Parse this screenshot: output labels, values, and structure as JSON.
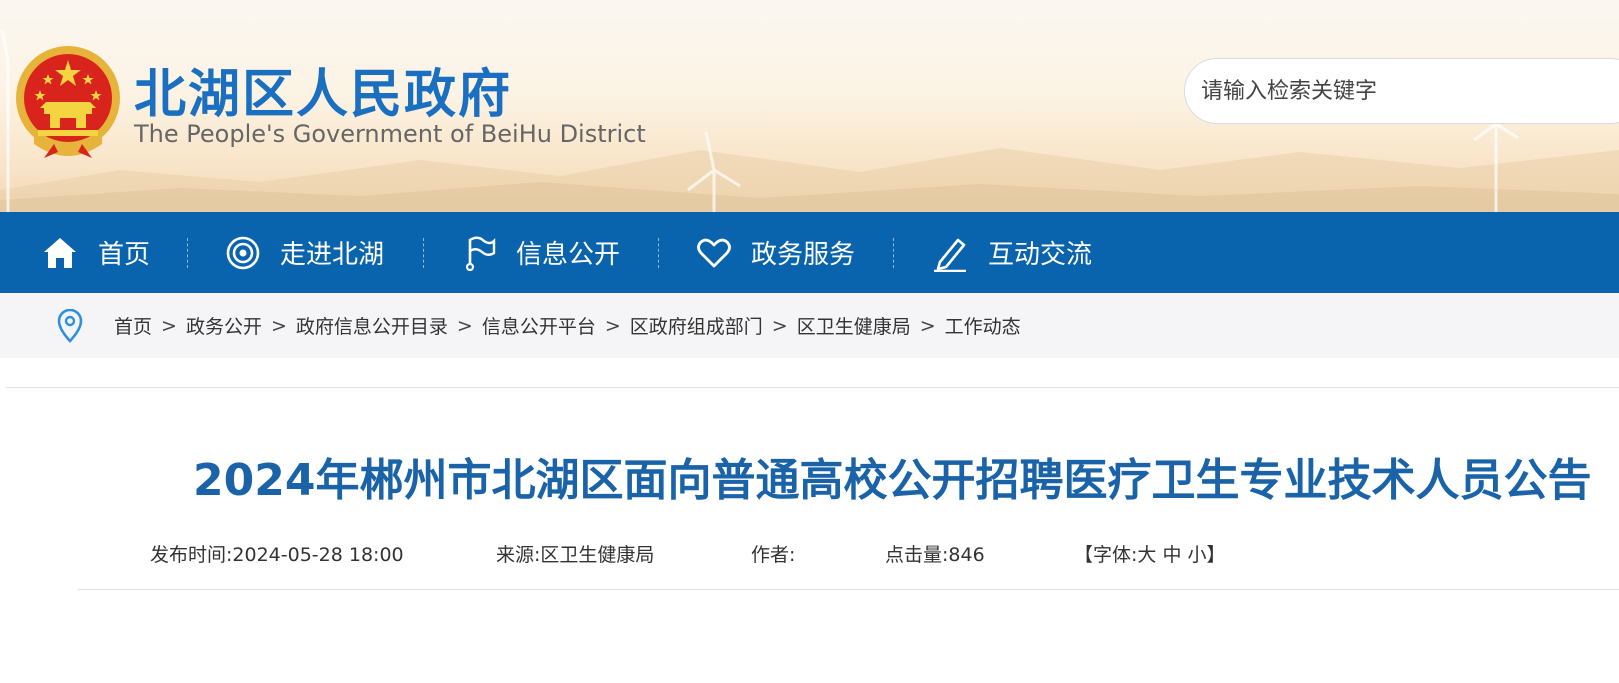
{
  "header": {
    "site_title_cn": "北湖区人民政府",
    "site_title_en": "The People's Government of BeiHu District",
    "emblem_icon": "national-emblem-icon",
    "brand_color": "#1a6fc1"
  },
  "search": {
    "placeholder": "请输入检索关键字"
  },
  "nav": {
    "background": "#0a64ad",
    "items": [
      {
        "label": "首页",
        "icon": "home-icon"
      },
      {
        "label": "走进北湖",
        "icon": "target-icon"
      },
      {
        "label": "信息公开",
        "icon": "flag-icon"
      },
      {
        "label": "政务服务",
        "icon": "heart-icon"
      },
      {
        "label": "互动交流",
        "icon": "pencil-icon"
      }
    ]
  },
  "breadcrumb": {
    "icon": "location-pin-icon",
    "separator": ">",
    "items": [
      "首页",
      "政务公开",
      "政府信息公开目录",
      "信息公开平台",
      "区政府组成部门",
      "区卫生健康局",
      "工作动态"
    ]
  },
  "article": {
    "title": "2024年郴州市北湖区面向普通高校公开招聘医疗卫生专业技术人员公告",
    "title_color": "#1a63a8",
    "meta": {
      "publish_label": "发布时间:",
      "publish_time": "2024-05-28 18:00",
      "source_label": "来源:",
      "source": "区卫生健康局",
      "author_label": "作者:",
      "author": "",
      "views_label": "点击量:",
      "views": "846",
      "font_open": "【字体:",
      "font_large": "大",
      "font_medium": "中",
      "font_small": "小",
      "font_close": "】"
    }
  }
}
